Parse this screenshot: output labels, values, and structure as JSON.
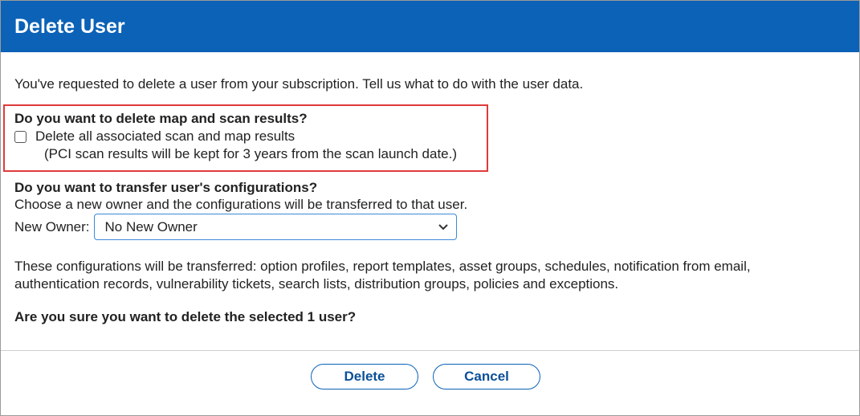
{
  "dialog": {
    "title": "Delete User",
    "intro": "You've requested to delete a user from your subscription. Tell us what to do with the user data.",
    "scan_section": {
      "question": "Do you want to delete map and scan results?",
      "checkbox_label": "Delete all associated scan and map results",
      "checked": false,
      "note": "(PCI scan results will be kept for 3 years from the scan launch date.)"
    },
    "config_section": {
      "question": "Do you want to transfer user's configurations?",
      "description": "Choose a new owner and the configurations will be transferred to that user.",
      "owner_label": "New Owner:",
      "owner_selected": "No New Owner"
    },
    "transfer_list": "These configurations will be transferred: option profiles, report templates, asset groups, schedules, notification from email, authentication records, vulnerability tickets, search lists, distribution groups, policies and exceptions.",
    "confirm_question": "Are you sure you want to delete the selected 1 user?",
    "buttons": {
      "delete": "Delete",
      "cancel": "Cancel"
    }
  },
  "colors": {
    "header": "#0b62b7",
    "highlight_border": "#e03a3a",
    "button_border": "#0b62b7"
  },
  "icons": {
    "select_toggle": "chevron-down-icon"
  }
}
